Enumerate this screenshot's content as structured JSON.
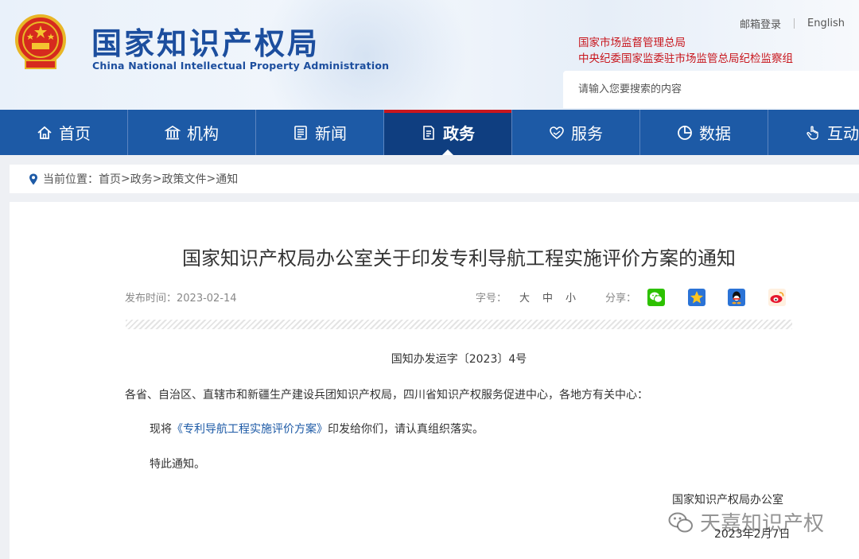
{
  "header": {
    "logo_cn": "国家知识产权局",
    "logo_en": "China National Intellectual Property Administration",
    "top_links": [
      "邮箱登录",
      "English"
    ],
    "org_links": [
      "国家市场监督管理总局",
      "中央纪委国家监委驻市场监管总局纪检监察组"
    ],
    "search_placeholder": "请输入您要搜索的内容"
  },
  "nav": {
    "items": [
      {
        "label": "首页",
        "icon": "home-icon"
      },
      {
        "label": "机构",
        "icon": "building-icon"
      },
      {
        "label": "新闻",
        "icon": "newspaper-icon"
      },
      {
        "label": "政务",
        "icon": "document-icon",
        "active": true
      },
      {
        "label": "服务",
        "icon": "heart-hand-icon"
      },
      {
        "label": "数据",
        "icon": "pie-chart-icon"
      },
      {
        "label": "互动",
        "icon": "hand-pointer-icon"
      }
    ]
  },
  "breadcrumb": {
    "prefix": "当前位置：",
    "items": [
      "首页",
      "政务",
      "政策文件",
      "通知"
    ],
    "separator": ">"
  },
  "article": {
    "title": "国家知识产权局办公室关于印发专利导航工程实施评价方案的通知",
    "date_label": "发布时间：2023-02-14",
    "size_label": "字号：",
    "sizes": [
      "大",
      "中",
      "小"
    ],
    "share_label": "分享：",
    "share_icons": [
      "wechat-icon",
      "qzone-icon",
      "qq-icon",
      "weibo-icon"
    ],
    "doc_number": "国知办发运字〔2023〕4号",
    "recipients": "各省、自治区、直辖市和新疆生产建设兵团知识产权局，四川省知识产权服务促进中心，各地方有关中心：",
    "body_prefix": "现将",
    "body_link": "《专利导航工程实施评价方案》",
    "body_suffix": "印发给你们，请认真组织落实。",
    "closing": "特此通知。",
    "signer": "国家知识产权局办公室",
    "sign_date": "2023年2月7日"
  },
  "watermark": {
    "text": "天嘉知识产权",
    "icon": "wechat-icon"
  },
  "colors": {
    "nav_blue": "#1d5aa6",
    "nav_active": "#0f3e80",
    "brand_red": "#c8161d",
    "logo_blue": "#1c4e9e"
  }
}
